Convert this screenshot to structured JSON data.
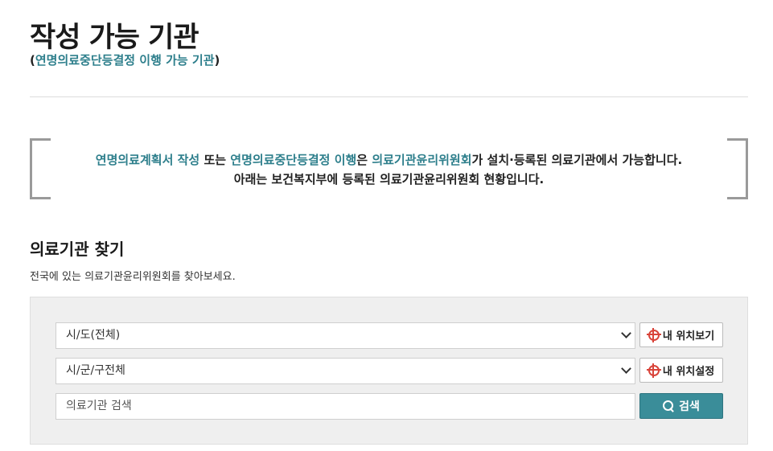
{
  "page": {
    "title": "작성 가능 기관",
    "subtitle_open": "(",
    "subtitle_link": "연명의료중단등결정 이행 가능 기관",
    "subtitle_close": ")"
  },
  "notice": {
    "line1_part1": "연명의료계획서 작성",
    "line1_part2": " 또는 ",
    "line1_part3": "연명의료중단등결정 이행",
    "line1_part4": "은 ",
    "line1_part5": "의료기관윤리위원회",
    "line1_part6": "가 설치·등록된 의료기관에서 가능합니다.",
    "line2": "아래는 보건복지부에 등록된 의료기관윤리위원회 현황입니다."
  },
  "finder": {
    "title": "의료기관 찾기",
    "description": "전국에 있는 의료기관윤리위원회를 찾아보세요.",
    "province_select": "시/도(전체)",
    "district_select": "시/군/구전체",
    "search_placeholder": "의료기관 검색",
    "my_location_view": "내 위치보기",
    "my_location_set": "내 위치설정",
    "search_button": "검색"
  },
  "colors": {
    "accent": "#2e7f8c",
    "search_button": "#3a8d99",
    "location_icon": "#d9443a"
  },
  "icons": [
    "target-icon",
    "search-icon",
    "chevron-down-icon"
  ]
}
